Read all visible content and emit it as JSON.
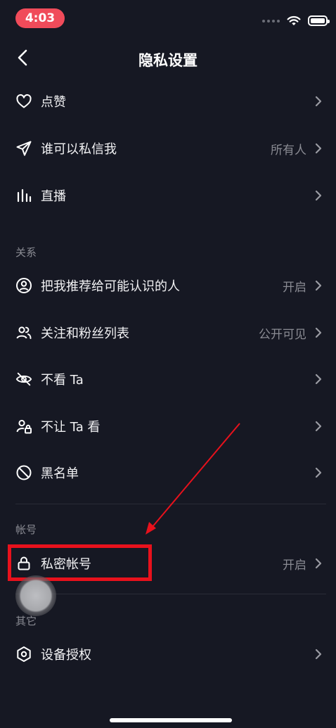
{
  "status": {
    "time": "4:03"
  },
  "header": {
    "title": "隐私设置"
  },
  "rows_top": [
    {
      "label": "点赞",
      "value": "",
      "icon": "heart-icon"
    },
    {
      "label": "谁可以私信我",
      "value": "所有人",
      "icon": "send-icon"
    },
    {
      "label": "直播",
      "value": "",
      "icon": "live-bars-icon"
    }
  ],
  "section_relations": "关系",
  "rows_relations": [
    {
      "label": "把我推荐给可能认识的人",
      "value": "开启",
      "icon": "user-circle-icon"
    },
    {
      "label": "关注和粉丝列表",
      "value": "公开可见",
      "icon": "users-icon"
    },
    {
      "label": "不看 Ta",
      "value": "",
      "icon": "eye-off-icon"
    },
    {
      "label": "不让 Ta 看",
      "value": "",
      "icon": "user-lock-icon"
    },
    {
      "label": "黑名单",
      "value": "",
      "icon": "block-icon"
    }
  ],
  "section_account": "帐号",
  "rows_account": [
    {
      "label": "私密帐号",
      "value": "开启",
      "icon": "lock-icon"
    }
  ],
  "section_other": "其它",
  "rows_other": [
    {
      "label": "设备授权",
      "value": "",
      "icon": "hexagon-icon"
    }
  ],
  "colors": {
    "background": "#161823",
    "annotation": "#e8111c",
    "time_pill": "#f04b5a"
  }
}
